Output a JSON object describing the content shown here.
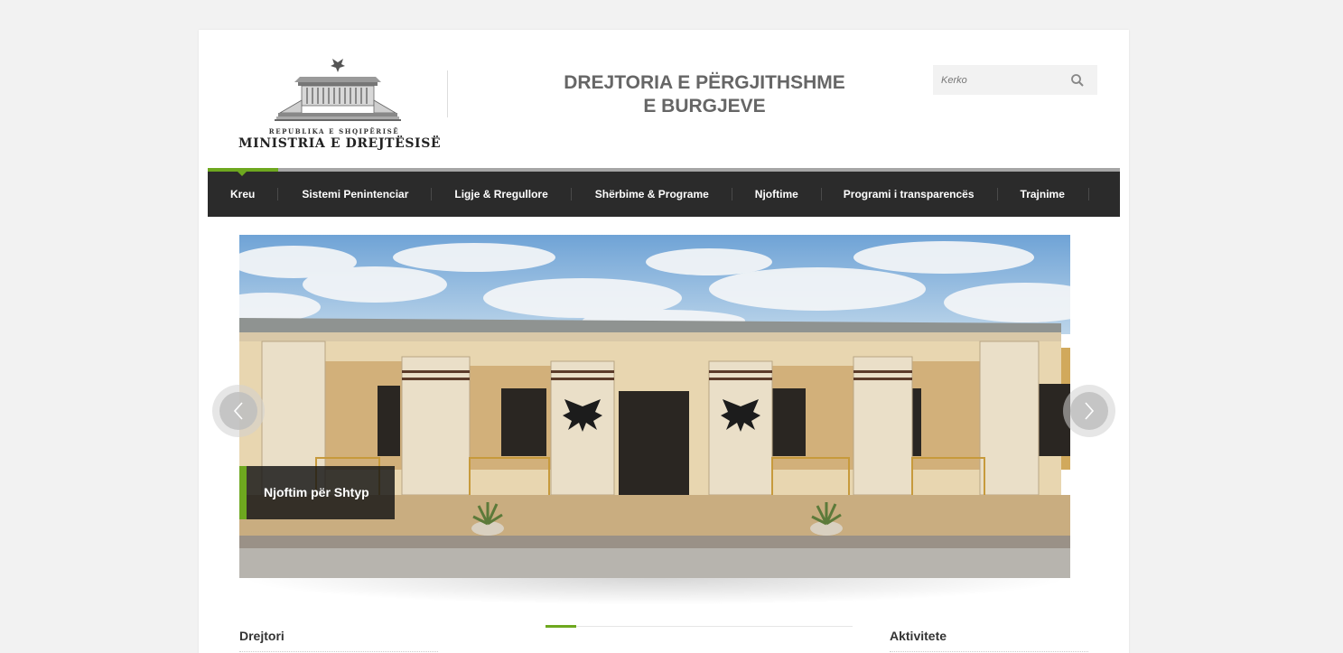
{
  "header": {
    "logo_republic": "REPUBLIKA E SHQIPËRISË",
    "logo_ministry": "MINISTRIA E DREJTËSISË",
    "title_line1": "DREJTORIA E PËRGJITHSHME",
    "title_line2": "E BURGJEVE"
  },
  "search": {
    "placeholder": "Kerko",
    "icon": "search-icon"
  },
  "nav": {
    "items": [
      {
        "label": "Kreu",
        "active": true
      },
      {
        "label": "Sistemi Penintenciar"
      },
      {
        "label": "Ligje & Rregullore"
      },
      {
        "label": "Shërbime & Programe"
      },
      {
        "label": "Njoftime"
      },
      {
        "label": "Programi i transparencës"
      },
      {
        "label": "Trajnime"
      }
    ]
  },
  "slider": {
    "caption": "Njoftim për Shtyp",
    "prev_icon": "chevron-left-icon",
    "next_icon": "chevron-right-icon"
  },
  "columns": {
    "left_title": "Drejtori",
    "right_title": "Aktivitete"
  },
  "colors": {
    "accent": "#6ea81f",
    "nav_bg": "#2b2b2b",
    "page_bg": "#f2f2f2",
    "title_gray": "#666666"
  }
}
